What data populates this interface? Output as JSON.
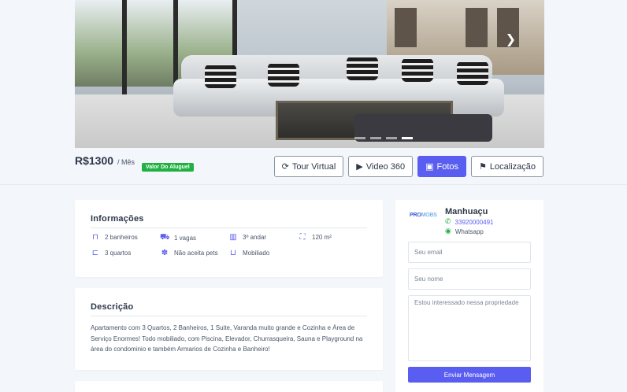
{
  "gallery": {
    "next_icon": "chevron-right-icon",
    "slides": 4,
    "active_slide": 4
  },
  "listing": {
    "price": "R$1300",
    "period": "/ Mês",
    "tag": "Valor Do Aluguel",
    "tag_color": "#1fb141"
  },
  "actions": [
    {
      "label": "Tour Virtual",
      "icon": "refresh-icon"
    },
    {
      "label": "Video 360",
      "icon": "play-icon"
    },
    {
      "label": "Fotos",
      "icon": "image-icon",
      "active": true
    },
    {
      "label": "Localização",
      "icon": "map-icon"
    }
  ],
  "info": {
    "title": "Informações",
    "items": [
      {
        "text": "2 banheiros",
        "icon": "bath-icon"
      },
      {
        "text": "1 vagas",
        "icon": "car-icon"
      },
      {
        "text": "3º andar",
        "icon": "building-icon"
      },
      {
        "text": "120 m²",
        "icon": "area-icon"
      },
      {
        "text": "3 quartos",
        "icon": "bed-icon"
      },
      {
        "text": "Não aceita pets",
        "icon": "paw-icon"
      },
      {
        "text": "Mobiliado",
        "icon": "sofa-icon"
      }
    ]
  },
  "description": {
    "title": "Descrição",
    "text": "Apartamento com 3 Quartos, 2 Banheiros, 1 Suite, Varanda muito grande e Cozinha e Área de Serviço Enormes! Todo mobiliado, com Piscina, Elevador, Churrasqueira, Sauna e Playground na área do condominio e também Armarios de Cozinha e Banheiro!"
  },
  "contact": {
    "logo_a": "PRO",
    "logo_b": "MOBS",
    "name": "Manhuaçu",
    "phone": "33920000491",
    "whatsapp": "Whatsapp",
    "email_placeholder": "Seu email",
    "name_placeholder": "Seu nome",
    "message_placeholder": "Estou interessado nessa propriedade",
    "send_label": "Enviar Mensagem"
  },
  "colors": {
    "accent": "#5a5ef0",
    "success": "#1fb141",
    "text": "#2d3748"
  }
}
